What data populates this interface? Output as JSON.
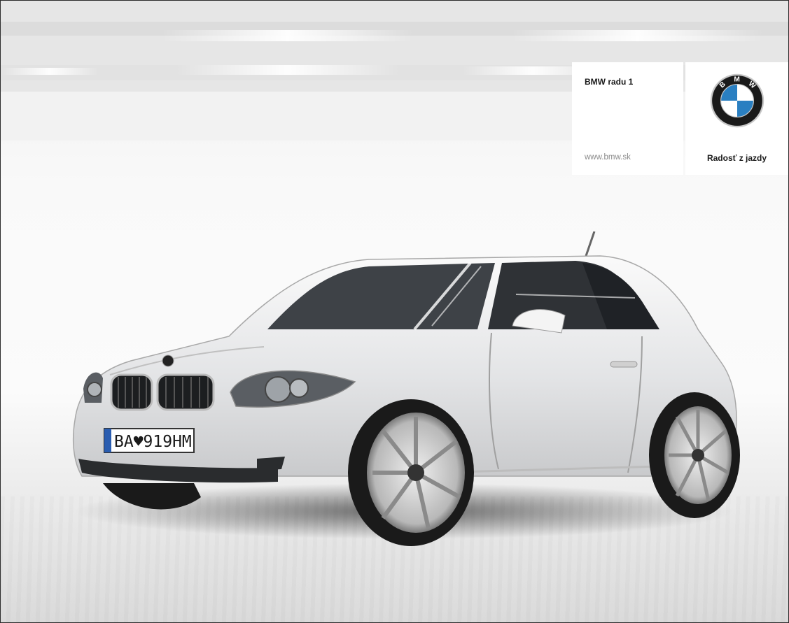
{
  "card": {
    "model": "BMW radu 1",
    "url": "www.bmw.sk",
    "slogan": "Radosť z jazdy"
  },
  "logo": {
    "letters": [
      "B",
      "M",
      "W"
    ],
    "colors": {
      "blue": "#2a7fc1",
      "white": "#ffffff",
      "ring": "#1a1a1a",
      "chrome": "#c8c8c8"
    }
  },
  "car": {
    "color": "#e8e9eb",
    "plate": "BA♥919HM"
  }
}
